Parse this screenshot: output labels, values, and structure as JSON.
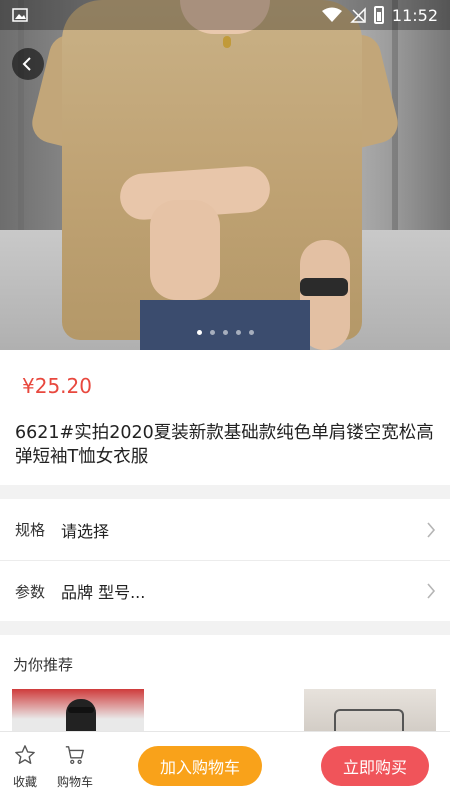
{
  "status_bar": {
    "time": "11:52",
    "icons": [
      "image-icon",
      "wifi-icon",
      "no-sim-icon",
      "battery-icon"
    ]
  },
  "gallery": {
    "image_subject": "product-photo-beige-tshirt",
    "slide_count": 5,
    "active_slide": 1
  },
  "product": {
    "price": "¥25.20",
    "title": "6621#实拍2020夏装新款基础款纯色单肩镂空宽松高弹短袖T恤女衣服"
  },
  "options": [
    {
      "label": "规格",
      "value": "请选择"
    },
    {
      "label": "参数",
      "value": "品牌 型号..."
    }
  ],
  "recommend": {
    "title": "为你推荐"
  },
  "bottom_bar": {
    "favorite_label": "收藏",
    "cart_label": "购物车",
    "add_to_cart": "加入购物车",
    "buy_now": "立即购买"
  },
  "colors": {
    "price": "#e8483e",
    "add_to_cart_bg": "#f9a21a",
    "buy_now_bg": "#f0545a"
  }
}
